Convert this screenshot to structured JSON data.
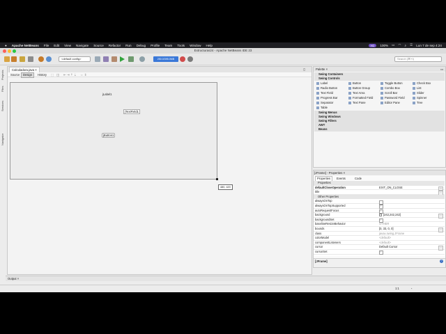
{
  "menubar": {
    "app_name": "Apache NetBeans",
    "items": [
      "File",
      "Edit",
      "View",
      "Navigate",
      "Source",
      "Refactor",
      "Run",
      "Debug",
      "Profile",
      "Team",
      "Tools",
      "Window",
      "Help"
    ],
    "badge": "HD",
    "battery": "100%",
    "datetime": "Lun 7 de sep  4:24"
  },
  "window": {
    "title": "Extructuras24 - Apache NetBeans IDE 23"
  },
  "toolbar": {
    "config_value": "<default config>",
    "memory": "250.0/395.0MB",
    "search_placeholder": "Search (⌘+I)"
  },
  "left_tabs": [
    "Projects",
    "Files",
    "Services",
    "Navigator"
  ],
  "editor": {
    "file_tab": "Calculadora.java",
    "view_tabs": [
      "Source",
      "Design",
      "History"
    ],
    "active_view": "Design",
    "components": {
      "label": "jLabel1",
      "text_field": "jTextField1",
      "button": "jButton1"
    },
    "size_tip": "480, 420"
  },
  "palette": {
    "title": "Palette",
    "swing_containers": "Swing Containers",
    "swing_controls": "Swing Controls",
    "controls": [
      "Label",
      "Button",
      "Toggle Button",
      "Check Box",
      "Radio Button",
      "Button Group",
      "Combo Box",
      "List",
      "Text Field",
      "Text Area",
      "Scroll Bar",
      "Slider",
      "Progress Bar",
      "Formatted Field",
      "Password Field",
      "Spinner",
      "Separator",
      "Text Pane",
      "Editor Pane",
      "Tree",
      "Table"
    ],
    "categories": [
      "Swing Menus",
      "Swing Windows",
      "Swing Fillers",
      "AWT",
      "Beans"
    ]
  },
  "properties": {
    "title": "[JFrame] - Properties",
    "tabs": [
      "Properties",
      "Events",
      "Code"
    ],
    "section_main": "Properties",
    "section_other": "Other Properties",
    "main_rows": [
      {
        "name": "defaultCloseOperation",
        "value": "EXIT_ON_CLOSE"
      },
      {
        "name": "title",
        "value": ""
      }
    ],
    "other_rows": [
      {
        "name": "alwaysOnTop",
        "value": ""
      },
      {
        "name": "alwaysOnTopSupported",
        "value": ""
      },
      {
        "name": "autoRequestFocus",
        "value": ""
      },
      {
        "name": "background",
        "value": "[242,242,242]"
      },
      {
        "name": "backgroundSet",
        "value": ""
      },
      {
        "name": "baselineResizeBehavior",
        "value": "OTHER"
      },
      {
        "name": "bounds",
        "value": "[0, 33, 0, 0]"
      },
      {
        "name": "class",
        "value": "javax.swing.JFrame"
      },
      {
        "name": "colorModel",
        "value": "<default>"
      },
      {
        "name": "componentListeners",
        "value": "<default>"
      },
      {
        "name": "cursor",
        "value": "Default Cursor"
      },
      {
        "name": "cursorSet",
        "value": ""
      }
    ],
    "footer": "[JFrame]"
  },
  "output": {
    "tab": "Output"
  },
  "statusbar": {
    "position": "1:1"
  },
  "colors": {
    "menubar_bg": "#1e1e22",
    "badge": "#6d4ec2",
    "memory_bar": "#3a78d8"
  }
}
